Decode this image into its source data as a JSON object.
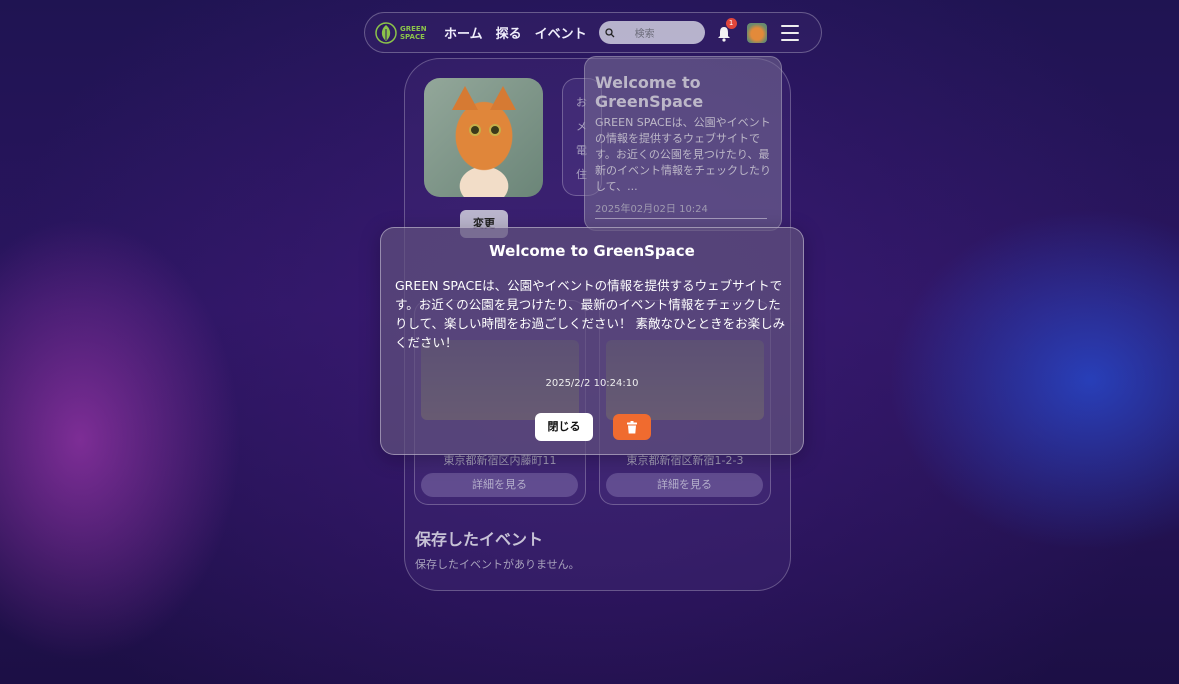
{
  "nav": {
    "logo_line1": "GREEN",
    "logo_line2": "SPACE",
    "links": [
      "ホーム",
      "探る",
      "イベント"
    ],
    "search_placeholder": "検索",
    "notification_count": "1"
  },
  "profile": {
    "change_label": "変更",
    "info_chars": [
      "お",
      "メ",
      "電",
      "住"
    ]
  },
  "notification_panel": {
    "title": "Welcome to GreenSpace",
    "body": "GREEN SPACEは、公園やイベントの情報を提供するウェブサイトです。お近くの公園を見つけたり、最新のイベント情報をチェックしたりして、...",
    "date": "2025年02月02日 10:24"
  },
  "parks": [
    {
      "address": "東京都新宿区内藤町11",
      "detail_label": "詳細を見る"
    },
    {
      "address": "東京都新宿区新宿1-2-3",
      "detail_label": "詳細を見る"
    }
  ],
  "saved_events": {
    "title": "保存したイベント",
    "empty_text": "保存したイベントがありません。"
  },
  "modal": {
    "title": "Welcome to GreenSpace",
    "body": "GREEN SPACEは、公園やイベントの情報を提供するウェブサイトです。お近くの公園を見つけたり、最新のイベント情報をチェックしたりして、楽しい時間をお過ごしください！ 素敵なひとときをお楽しみください！",
    "date": "2025/2/2 10:24:10",
    "close_label": "閉じる",
    "delete_icon": "trash-icon"
  },
  "colors": {
    "accent_green": "#8bc34a",
    "delete_orange": "#f06b2f",
    "badge_red": "#e0463b"
  }
}
